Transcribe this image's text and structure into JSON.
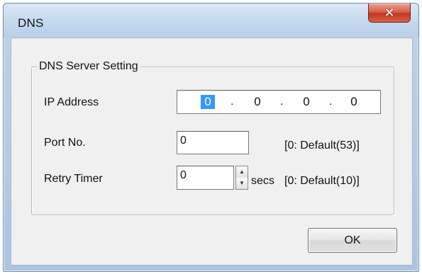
{
  "window": {
    "title": "DNS",
    "close_icon": "close-x-icon"
  },
  "group": {
    "label": "DNS Server Setting"
  },
  "fields": {
    "ip": {
      "label": "IP Address",
      "octets": [
        "0",
        "0",
        "0",
        "0"
      ],
      "separator": "."
    },
    "port": {
      "label": "Port No.",
      "value": "0",
      "hint": "[0: Default(53)]"
    },
    "retry": {
      "label": "Retry Timer",
      "value": "0",
      "unit": "secs",
      "hint": "[0: Default(10)]",
      "spin_up_icon": "spin-up-arrow-icon",
      "spin_down_icon": "spin-down-arrow-icon"
    }
  },
  "buttons": {
    "ok_label": "OK"
  },
  "colors": {
    "selection": "#3399ff",
    "close_button": "#c4371f",
    "dialog_background": "#f0f0f0"
  }
}
